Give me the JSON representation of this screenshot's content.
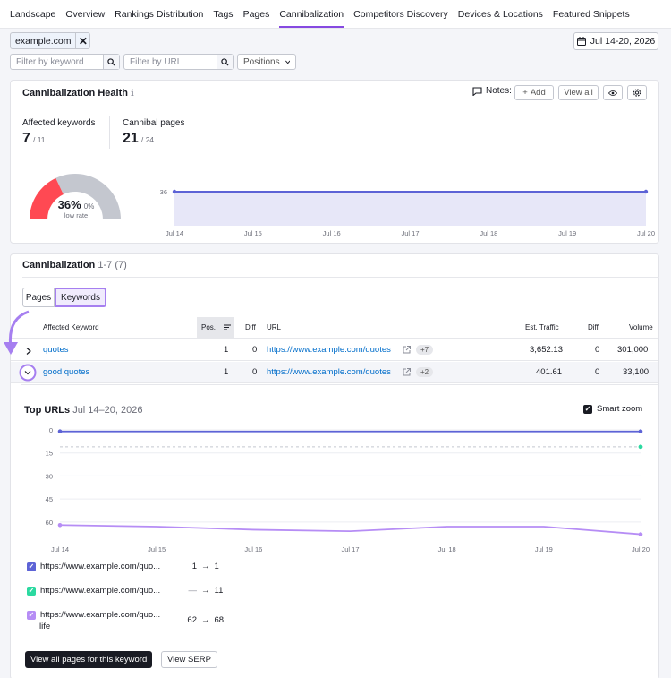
{
  "nav": {
    "tabs": [
      "Landscape",
      "Overview",
      "Rankings Distribution",
      "Tags",
      "Pages",
      "Cannibalization",
      "Competitors Discovery",
      "Devices & Locations",
      "Featured Snippets"
    ],
    "active": "Cannibalization"
  },
  "domain_chip": "example.com",
  "date_range": "Jul 14-20, 2026",
  "filters": {
    "keyword_placeholder": "Filter by keyword",
    "url_placeholder": "Filter by URL",
    "positions_label": "Positions"
  },
  "health": {
    "title": "Cannibalization Health",
    "notes_label": "Notes:",
    "add_label": "Add",
    "view_all_label": "View all",
    "affected_keywords_label": "Affected keywords",
    "affected_keywords_value": "7",
    "affected_keywords_total": "/ 11",
    "cannibal_pages_label": "Cannibal pages",
    "cannibal_pages_value": "21",
    "cannibal_pages_total": "/ 24",
    "gauge_percent": "36%",
    "gauge_change": "0%",
    "gauge_caption": "low rate",
    "gauge_fraction": 0.36,
    "colors": {
      "gauge_fill": "#ff4953",
      "gauge_track": "#c4c7cf",
      "line": "#5d63d6",
      "area": "#e7e7f8"
    }
  },
  "health_chart": {
    "type": "area",
    "x": [
      "Jul 14",
      "Jul 15",
      "Jul 16",
      "Jul 17",
      "Jul 18",
      "Jul 19",
      "Jul 20"
    ],
    "y_tick": "36",
    "series": [
      {
        "values": [
          36,
          36,
          36,
          36,
          36,
          36,
          36
        ]
      }
    ]
  },
  "cannibalization": {
    "title": "Cannibalization",
    "range": "1-7",
    "count": "(7)",
    "segments": [
      "Pages",
      "Keywords"
    ],
    "active_segment": "Keywords",
    "columns": [
      "Affected Keyword",
      "Pos.",
      "Diff",
      "URL",
      "Est. Traffic",
      "Diff",
      "Volume"
    ],
    "rows": [
      {
        "keyword": "quotes",
        "pos": "1",
        "diff": "0",
        "url": "https://www.example.com/quotes",
        "more": "+7",
        "traffic": "3,652.13",
        "traffic_diff": "0",
        "volume": "301,000"
      },
      {
        "keyword": "good quotes",
        "pos": "1",
        "diff": "0",
        "url": "https://www.example.com/quotes",
        "more": "+2",
        "traffic": "401.61",
        "traffic_diff": "0",
        "volume": "33,100"
      }
    ]
  },
  "top_urls": {
    "title": "Top URLs",
    "date": "Jul 14–20, 2026",
    "smart_zoom_label": "Smart zoom",
    "legend": [
      {
        "url": "https://www.example.com/quo...",
        "from": "1",
        "to": "1",
        "color": "#5d63d6"
      },
      {
        "url": "https://www.example.com/quo...",
        "from": "—",
        "to": "11",
        "color": "#2bd9a0"
      },
      {
        "url": "https://www.example.com/quo...",
        "extra": "life",
        "from": "62",
        "to": "68",
        "color": "#b68df5"
      }
    ],
    "view_all_label": "View all pages for this keyword",
    "view_serp_label": "View SERP"
  },
  "chart_data": {
    "type": "line",
    "x": [
      "Jul 14",
      "Jul 15",
      "Jul 16",
      "Jul 17",
      "Jul 18",
      "Jul 19",
      "Jul 20"
    ],
    "y_ticks": [
      "0",
      "15",
      "30",
      "45",
      "60"
    ],
    "ylim": [
      0,
      70
    ],
    "y_inverted": true,
    "series": [
      {
        "values": [
          1,
          1,
          1,
          1,
          1,
          1,
          1
        ],
        "color": "#5d63d6"
      },
      {
        "values": [
          null,
          null,
          null,
          null,
          null,
          null,
          11
        ],
        "color": "#2bd9a0"
      },
      {
        "values": [
          62,
          63,
          65,
          66,
          63,
          63,
          68
        ],
        "color": "#b68df5"
      }
    ]
  }
}
